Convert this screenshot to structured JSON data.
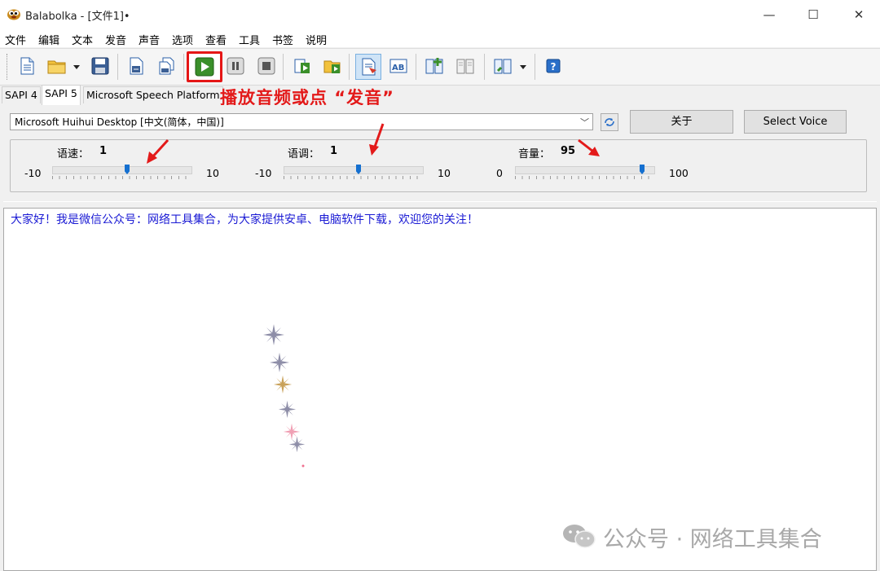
{
  "window": {
    "title": "Balabolka - [文件1]•",
    "minimize": "—",
    "maximize": "☐",
    "close": "✕"
  },
  "menu": [
    "文件",
    "编辑",
    "文本",
    "发音",
    "声音",
    "选项",
    "查看",
    "工具",
    "书签",
    "说明"
  ],
  "toolbar": {
    "icons": [
      "new-file-icon",
      "open-folder-icon",
      "dropdown-icon",
      "save-icon",
      "export-audio-icon",
      "batch-convert-icon",
      "play-icon",
      "pause-icon",
      "stop-icon",
      "read-clipboard-icon",
      "read-file-icon",
      "check-text-icon",
      "spell-ab-icon",
      "add-bookmark-icon",
      "open-book-icon",
      "pronunciation-dict-icon",
      "dropdown-icon",
      "help-icon"
    ]
  },
  "tabs": [
    "SAPI 4",
    "SAPI 5",
    "Microsoft Speech Platform"
  ],
  "active_tab": "SAPI 5",
  "annotation": "播放音频或点 “发音”",
  "voice": {
    "selected": "Microsoft Huihui Desktop [中文(简体，中国)]",
    "about_label": "关于",
    "select_voice_label": "Select Voice"
  },
  "sliders": {
    "rate": {
      "label": "语速：",
      "value": "1",
      "min": "-10",
      "max": "10",
      "level": 1
    },
    "pitch": {
      "label": "语调：",
      "value": "1",
      "min": "-10",
      "max": "10",
      "level": 1
    },
    "volume": {
      "label": "音量：",
      "value": "95",
      "min": "0",
      "max": "100",
      "level": 95
    }
  },
  "editor": {
    "text": "大家好！我是微信公众号：网络工具集合，为大家提供安卓、电脑软件下载，欢迎您的关注！"
  },
  "watermark": "公众号 · 网络工具集合",
  "colors": {
    "annotation": "#e31a1a",
    "editor_text": "#1a1ad4",
    "slider_thumb": "#1570d0"
  }
}
